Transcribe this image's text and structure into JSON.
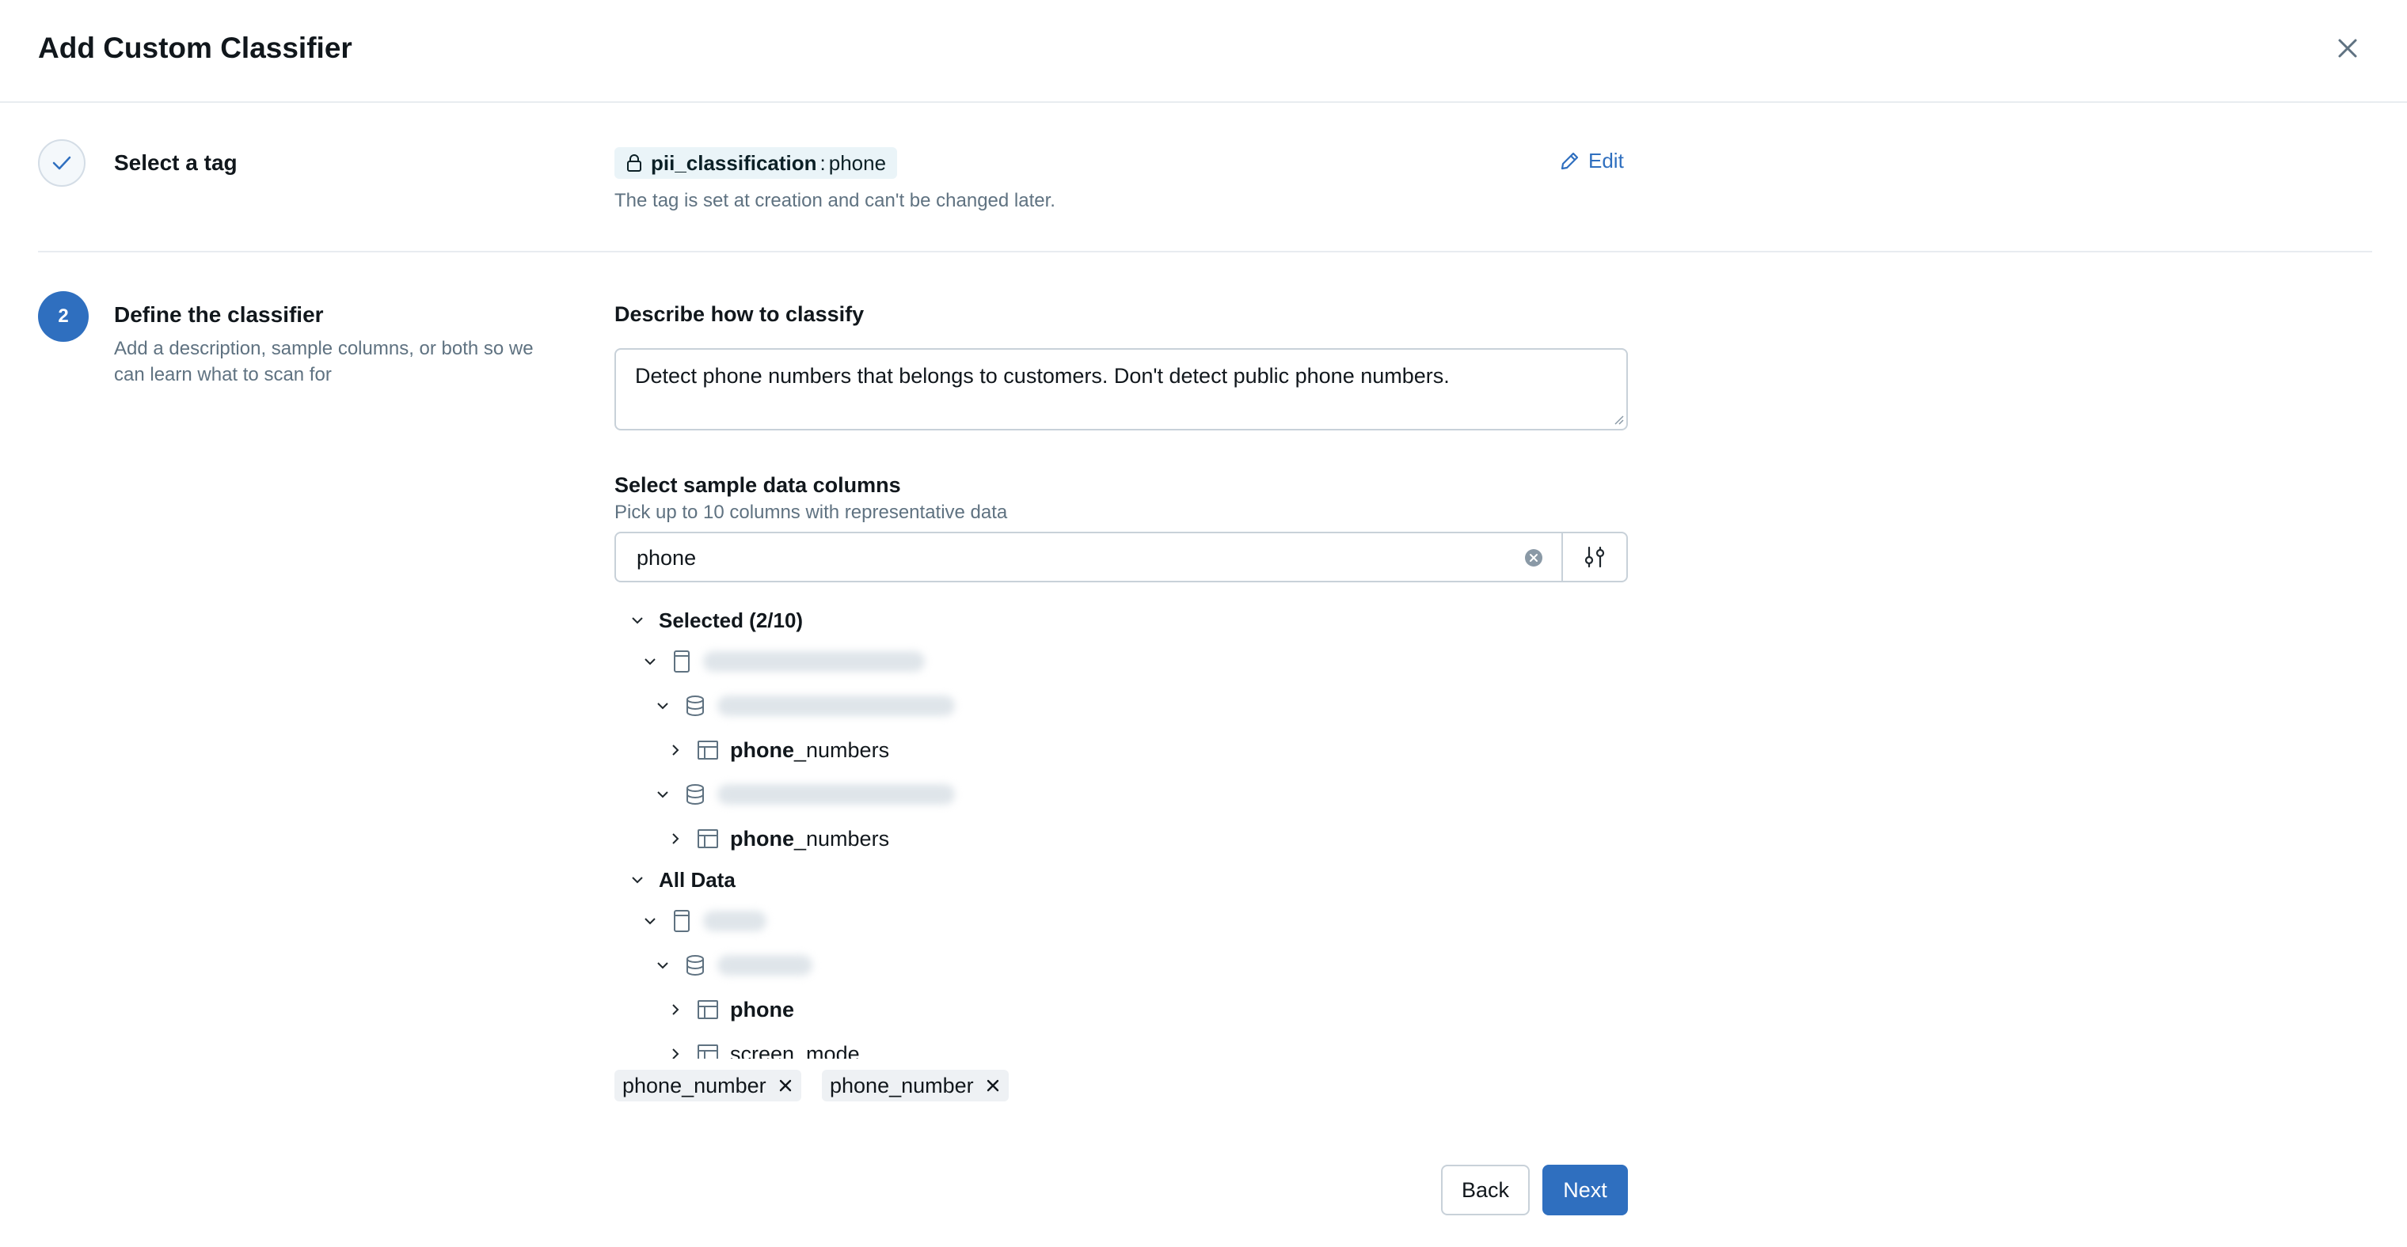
{
  "header": {
    "title": "Add Custom Classifier"
  },
  "steps": {
    "select_tag": {
      "title": "Select a tag",
      "tag_key": "pii_classification",
      "tag_separator": ":",
      "tag_value": "phone",
      "note": "The tag is set at creation and can't be changed later.",
      "edit_label": "Edit"
    },
    "define": {
      "number": "2",
      "title": "Define the classifier",
      "description": "Add a description, sample columns, or both so we can learn what to scan for",
      "describe_label": "Describe how to classify",
      "describe_value": "Detect phone numbers that belongs to customers. Don't detect public phone numbers.",
      "sample_label": "Select sample data columns",
      "sample_hint": "Pick up to 10 columns with representative data",
      "search_value": "phone"
    }
  },
  "tree": {
    "selected_group": "Selected (2/10)",
    "selected_tables": [
      {
        "highlight": "phone",
        "rest": "_numbers"
      },
      {
        "highlight": "phone",
        "rest": "_numbers"
      }
    ],
    "all_group": "All Data",
    "all_tables": [
      {
        "highlight": "phone",
        "rest": ""
      },
      {
        "highlight": "",
        "rest": "screen_mode"
      }
    ]
  },
  "chips": [
    "phone_number",
    "phone_number"
  ],
  "footer": {
    "back_label": "Back",
    "next_label": "Next"
  },
  "colors": {
    "primary": "#2f6fbf",
    "tag_bg": "#eaf4f8",
    "border": "#c8d1d9",
    "muted_text": "#5f7281"
  }
}
